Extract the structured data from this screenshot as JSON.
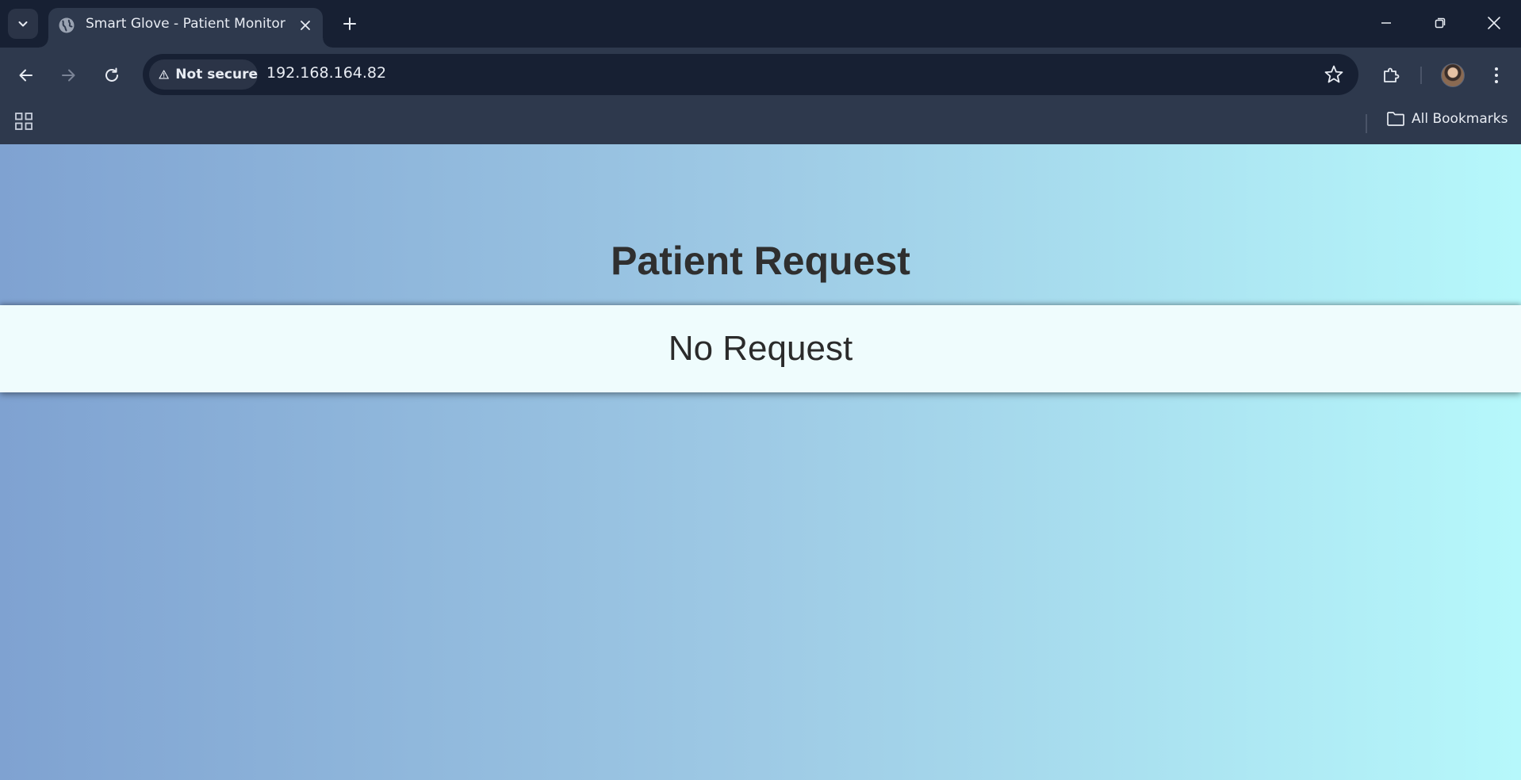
{
  "browser": {
    "tab": {
      "title": "Smart Glove - Patient Monitor",
      "favicon": "globe-icon"
    },
    "address_bar": {
      "security_label": "Not secure",
      "url": "192.168.164.82"
    },
    "bookmarks_bar": {
      "all_bookmarks_label": "All Bookmarks"
    },
    "colors": {
      "frame": "#172033",
      "toolbar": "#2e394d",
      "omnibox": "#172033",
      "text": "#e8ecf3"
    }
  },
  "page": {
    "heading": "Patient Request",
    "status_text": "No Request",
    "colors": {
      "gradient_start": "#7fa2d1",
      "gradient_end": "#b6f8fb",
      "status_bar_bg": "#effcfd",
      "heading_text": "#2f2f2f"
    }
  }
}
